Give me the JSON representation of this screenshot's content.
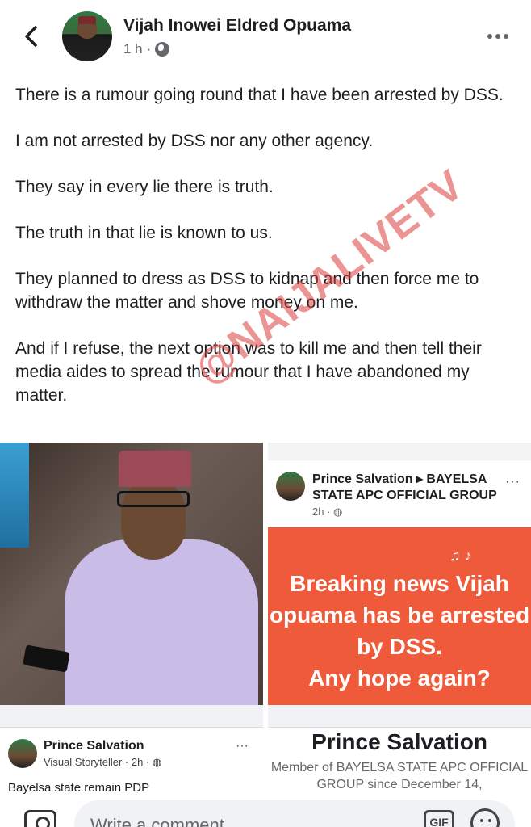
{
  "header": {
    "poster_name": "Vijah Inowei Eldred Opuama",
    "time": "1 h",
    "separator": "·",
    "audience_icon": "globe-icon",
    "back_icon": "chevron-left-icon",
    "more_icon": "more-horizontal-icon"
  },
  "post": {
    "paragraphs": [
      "There is a rumour going round that I have been arrested by DSS.",
      "I am not arrested by DSS nor any other agency.",
      "They say in every lie there is truth.",
      "The truth in that lie is known to us.",
      "They planned to dress as DSS to kidnap and then force me to withdraw the matter and shove money on me.",
      "And if I refuse, the next option was to kill me and then tell their media aides to spread the rumour that I have abandoned my matter."
    ],
    "watermark": "@NAIJALIVETV"
  },
  "screenshot_post": {
    "name": "Prince Salvation ▸ BAYELSA STATE APC OFFICIAL GROUP",
    "meta": "2h · ",
    "more": "···",
    "banner_lines": "Breaking news Vijah opuama has be arrested by DSS.",
    "banner_bottom": "Any hope again?"
  },
  "screenshot_profile": {
    "name": "Prince Salvation",
    "meta": "Visual Storyteller · 2h · ",
    "more": "···",
    "text": "Bayelsa state remain PDP"
  },
  "screenshot_group": {
    "title": "Prince Salvation",
    "subtitle": "Member of BAYELSA STATE APC OFFICIAL GROUP since December 14,"
  },
  "comment": {
    "placeholder": "Write a comment...",
    "camera_icon": "camera-icon",
    "gif_label": "GIF",
    "emoji_icon": "emoji-icon"
  },
  "colors": {
    "banner": "#ee5a3a",
    "watermark": "#dc3c3c",
    "meta_text": "#65676b"
  }
}
